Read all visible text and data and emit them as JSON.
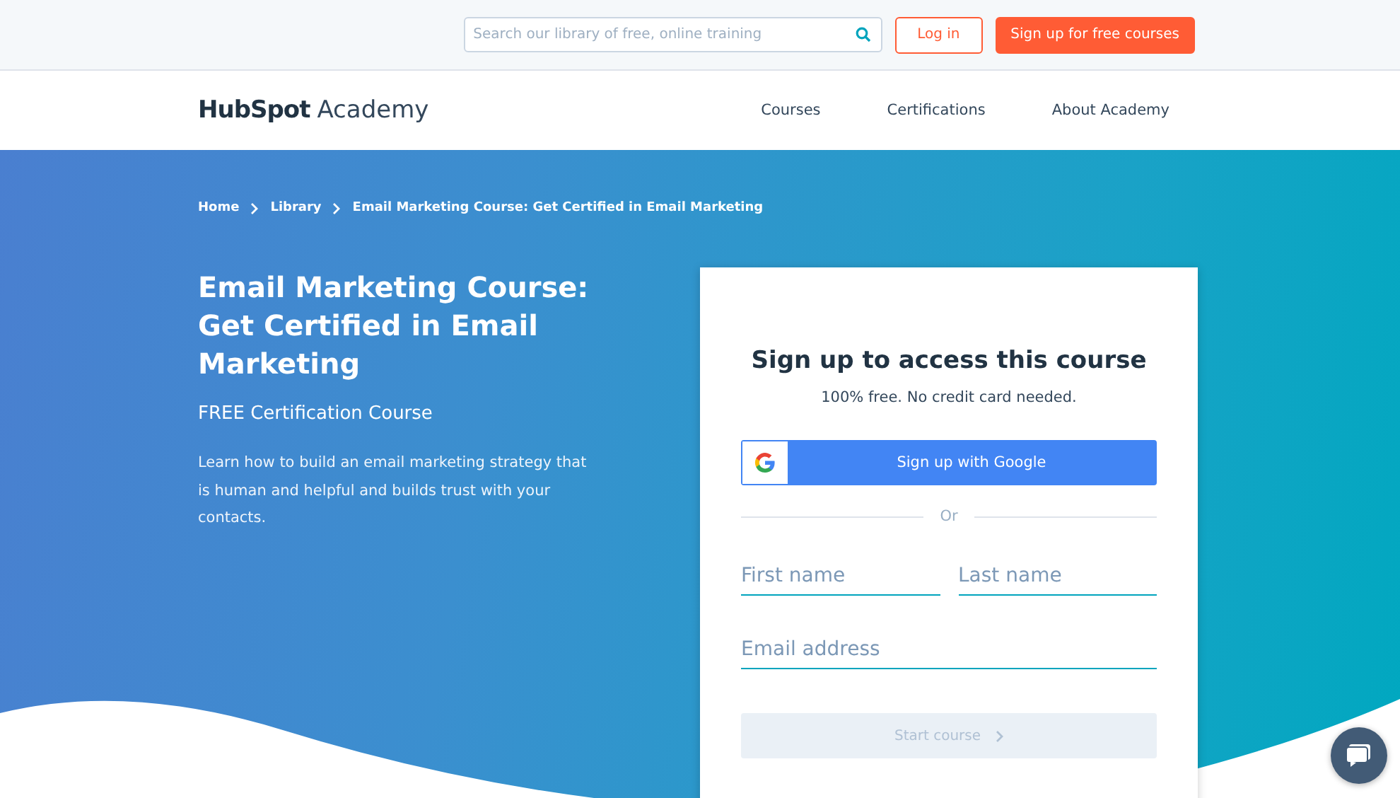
{
  "top_bar": {
    "search": {
      "placeholder": "Search our library of free, online training"
    },
    "buttons": [
      {
        "label": "Log in",
        "kind": "outline"
      },
      {
        "label": "Sign up for free courses",
        "kind": "solid"
      }
    ]
  },
  "nav": {
    "logo": {
      "brand": "HubSpot",
      "product": "Academy"
    },
    "links": [
      "Courses",
      "Certifications",
      "About Academy"
    ]
  },
  "hero": {
    "breadcrumbs": [
      "Home",
      "Library",
      "Email Marketing Course: Get Certified in Email Marketing"
    ],
    "title": "Email Marketing Course: Get Certified in Email Marketing",
    "subtitle": "FREE Certification Course",
    "description": "Learn how to build an email marketing strategy that is human and helpful and builds trust with your contacts."
  },
  "signup": {
    "title": "Sign up to access this course",
    "note": "100% free. No credit card needed.",
    "google_button": "Sign up with Google",
    "divider": "Or",
    "fields": [
      {
        "placeholder": "First name"
      },
      {
        "placeholder": "Last name"
      },
      {
        "placeholder": "Email address"
      }
    ],
    "submit": {
      "label": "Start course",
      "disabled": true
    }
  }
}
